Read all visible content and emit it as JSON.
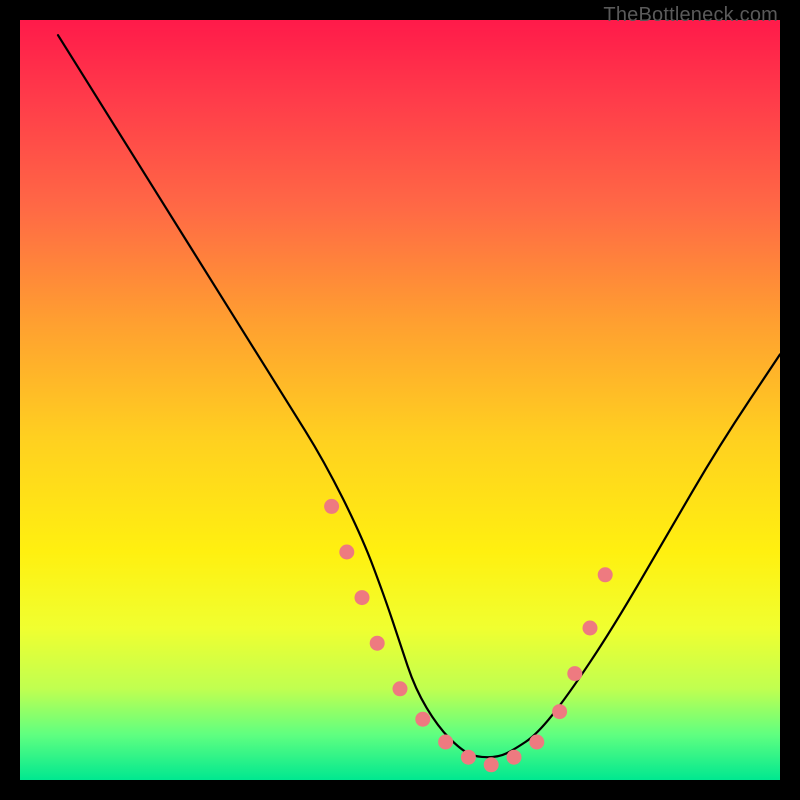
{
  "watermark": "TheBottleneck.com",
  "chart_data": {
    "type": "line",
    "title": "",
    "xlabel": "",
    "ylabel": "",
    "xlim": [
      0,
      100
    ],
    "ylim": [
      0,
      100
    ],
    "series": [
      {
        "name": "bottleneck-curve",
        "x": [
          5,
          10,
          15,
          20,
          25,
          30,
          35,
          40,
          45,
          48,
          50,
          52,
          55,
          58,
          60,
          63,
          65,
          68,
          72,
          78,
          85,
          92,
          100
        ],
        "y": [
          98,
          90,
          82,
          74,
          66,
          58,
          50,
          42,
          32,
          24,
          18,
          12,
          7,
          4,
          3,
          3,
          4,
          6,
          11,
          20,
          32,
          44,
          56
        ]
      }
    ],
    "markers": {
      "name": "highlight-dots",
      "color": "#ee7a80",
      "x": [
        41,
        43,
        45,
        47,
        50,
        53,
        56,
        59,
        62,
        65,
        68,
        71,
        73,
        75,
        77
      ],
      "y": [
        36,
        30,
        24,
        18,
        12,
        8,
        5,
        3,
        2,
        3,
        5,
        9,
        14,
        20,
        27
      ]
    }
  }
}
